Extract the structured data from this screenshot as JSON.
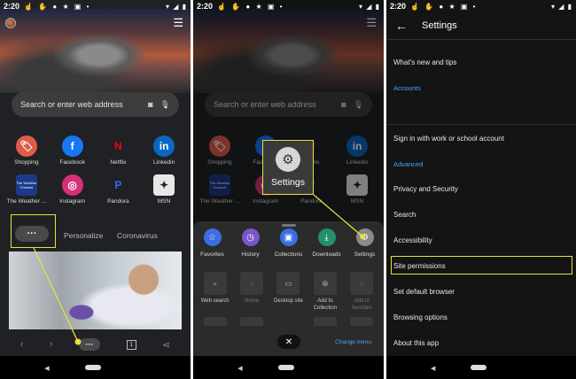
{
  "status_time": "2:20",
  "status_icons": "☝ ✋ ● ★ ▣ •",
  "status_right": "▾ ◢ ▮",
  "home": {
    "search_placeholder": "Search or enter web address",
    "tiles": [
      {
        "label": "Shopping",
        "icon": "tag-icon",
        "glyph": "🏷",
        "color": "#e05c4a"
      },
      {
        "label": "Facebook",
        "icon": "facebook-icon",
        "glyph": "f",
        "color": "#1877f2"
      },
      {
        "label": "Netflix",
        "icon": "netflix-icon",
        "glyph": "N",
        "color": "#202124"
      },
      {
        "label": "Linkedin",
        "icon": "linkedin-icon",
        "glyph": "in",
        "color": "#0a66c2"
      },
      {
        "label": "The Weather ...",
        "icon": "weather-channel-icon",
        "glyph": "",
        "color": "#1a3a8a"
      },
      {
        "label": "Instagram",
        "icon": "instagram-icon",
        "glyph": "◎",
        "color": "#d6307a"
      },
      {
        "label": "Pandora",
        "icon": "pandora-icon",
        "glyph": "P",
        "color": "#202124"
      },
      {
        "label": "MSN",
        "icon": "msn-icon",
        "glyph": "✦",
        "color": "#e8e8e8"
      }
    ],
    "weather_logo_text": "The Weather Channel",
    "feed_tabs": [
      "Personalize",
      "Coronavirus"
    ],
    "more_label": "···",
    "tab_count": "1"
  },
  "menu": {
    "popup_label": "Settings",
    "items": [
      {
        "label": "Favorites",
        "icon": "star-icon",
        "glyph": "☆",
        "color": "#3b6ee0"
      },
      {
        "label": "History",
        "icon": "history-icon",
        "glyph": "◷",
        "color": "#7b55c9"
      },
      {
        "label": "Collections",
        "icon": "collections-icon",
        "glyph": "▣",
        "color": "#3b6ee0"
      },
      {
        "label": "Downloads",
        "icon": "download-icon",
        "glyph": "⤓",
        "color": "#23906c"
      },
      {
        "label": "Settings",
        "icon": "gear-icon",
        "glyph": "⚙",
        "color": "#8a8a8a"
      }
    ],
    "grid": [
      {
        "label": "Web search",
        "icon": "search-icon",
        "glyph": "⌕",
        "enabled": true
      },
      {
        "label": "Home",
        "icon": "home-icon",
        "glyph": "⌂",
        "enabled": false
      },
      {
        "label": "Desktop site",
        "icon": "desktop-icon",
        "glyph": "▭",
        "enabled": true
      },
      {
        "label": "Add to Collection",
        "icon": "add-collection-icon",
        "glyph": "⊕",
        "enabled": true
      },
      {
        "label": "Add to favorites",
        "icon": "add-favorite-icon",
        "glyph": "☆",
        "enabled": false
      }
    ],
    "close_label": "✕",
    "change_menu": "Change menu"
  },
  "settings": {
    "title": "Settings",
    "whats_new": "What's new and tips",
    "accounts_header": "Accounts",
    "sign_in": "Sign in with work or school account",
    "advanced_header": "Advanced",
    "items": [
      "Privacy and Security",
      "Search",
      "Accessibility",
      "Site permissions",
      "Set default browser",
      "Browsing options",
      "About this app"
    ]
  },
  "colors": {
    "highlight": "#e9df3f",
    "accent": "#4da3ff"
  }
}
